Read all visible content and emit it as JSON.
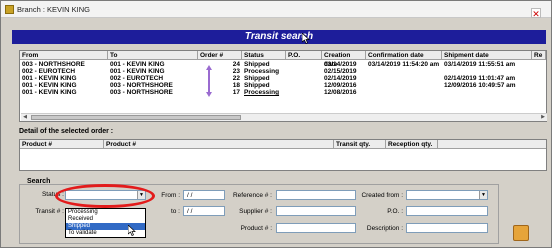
{
  "window": {
    "title": "Branch : KEVIN KING"
  },
  "banner": {
    "title": "Transit search"
  },
  "transit_grid": {
    "columns": [
      "From",
      "To",
      "Order #",
      "Status",
      "P.O.",
      "Creation date",
      "Confirmation date",
      "Shipment date",
      "Re"
    ],
    "rows": [
      {
        "from": "003 - NORTHSHORE",
        "to": "001 - KEVIN KING",
        "order": "24",
        "status": "Shipped",
        "po": "",
        "created": "03/14/2019",
        "confirmed": "03/14/2019 11:54:20 am",
        "shipped": "03/14/2019 11:55:51 am"
      },
      {
        "from": "002 - EUROTECH",
        "to": "001 - KEVIN KING",
        "order": "23",
        "status": "Processing",
        "po": "",
        "created": "02/15/2019",
        "confirmed": "",
        "shipped": ""
      },
      {
        "from": "001 - KEVIN KING",
        "to": "002 - EUROTECH",
        "order": "22",
        "status": "Shipped",
        "po": "",
        "created": "02/14/2019",
        "confirmed": "",
        "shipped": "02/14/2019 11:01:47 am"
      },
      {
        "from": "001 - KEVIN KING",
        "to": "003 - NORTHSHORE",
        "order": "18",
        "status": "Shipped",
        "po": "",
        "created": "12/09/2016",
        "confirmed": "",
        "shipped": "12/09/2016 10:49:57 am"
      },
      {
        "from": "001 - KEVIN KING",
        "to": "003 - NORTHSHORE",
        "order": "17",
        "status": "Processing",
        "po": "",
        "created": "12/08/2016",
        "confirmed": "",
        "shipped": ""
      }
    ]
  },
  "detail": {
    "title": "Detail of the selected order :",
    "columns": [
      "Product #",
      "Product #",
      "Transit qty.",
      "Reception qty."
    ]
  },
  "search": {
    "title": "Search",
    "status_label": "Status :",
    "transit_label": "Transit # :",
    "from_label": "From :",
    "to_label": "to :",
    "from_value": "/ /",
    "to_value": "/ /",
    "reference_label": "Reference # :",
    "supplier_label": "Supplier # :",
    "product_label": "Product # :",
    "created_from_label": "Created from :",
    "po_label": "P.O. :",
    "description_label": "Description :",
    "status_options": [
      "Processing",
      "Received",
      "Shipped",
      "To validate"
    ],
    "status_selected_index": 2
  },
  "colors": {
    "banner": "#1d1d9a",
    "highlight": "#e31b1b",
    "selection": "#316ac5",
    "arrow": "#9a6bd0"
  }
}
